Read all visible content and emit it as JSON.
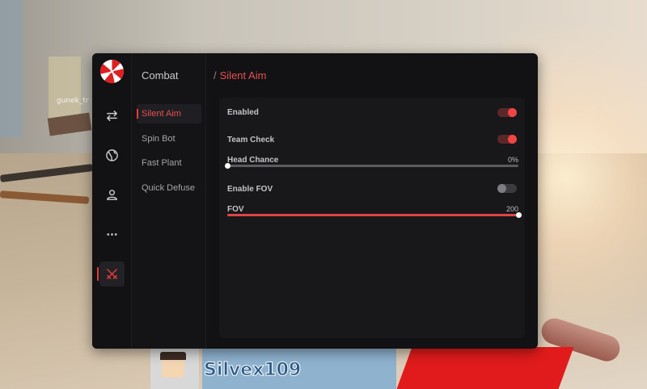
{
  "background": {
    "player_name": "Silvex109",
    "tag_text": "gunek_tr"
  },
  "menu": {
    "section_title": "Combat",
    "breadcrumb_sep": "/",
    "breadcrumb_current": "Silent Aim",
    "accent_color": "#e53b3b",
    "rail_icons": [
      "swap-arrows-icon",
      "globe-icon",
      "user-icon",
      "more-dots-icon",
      "crossed-swords-icon"
    ],
    "subnav": [
      {
        "label": "Silent Aim",
        "active": true
      },
      {
        "label": "Spin Bot",
        "active": false
      },
      {
        "label": "Fast Plant",
        "active": false
      },
      {
        "label": "Quick Defuse",
        "active": false
      }
    ],
    "settings": {
      "enabled": {
        "label": "Enabled",
        "on": true
      },
      "team_check": {
        "label": "Team Check",
        "on": true
      },
      "head_chance": {
        "label": "Head Chance",
        "value_text": "0%",
        "fraction": 0.0
      },
      "enable_fov": {
        "label": "Enable FOV",
        "on": false
      },
      "fov": {
        "label": "FOV",
        "value_text": "200",
        "fraction": 1.0
      }
    }
  }
}
